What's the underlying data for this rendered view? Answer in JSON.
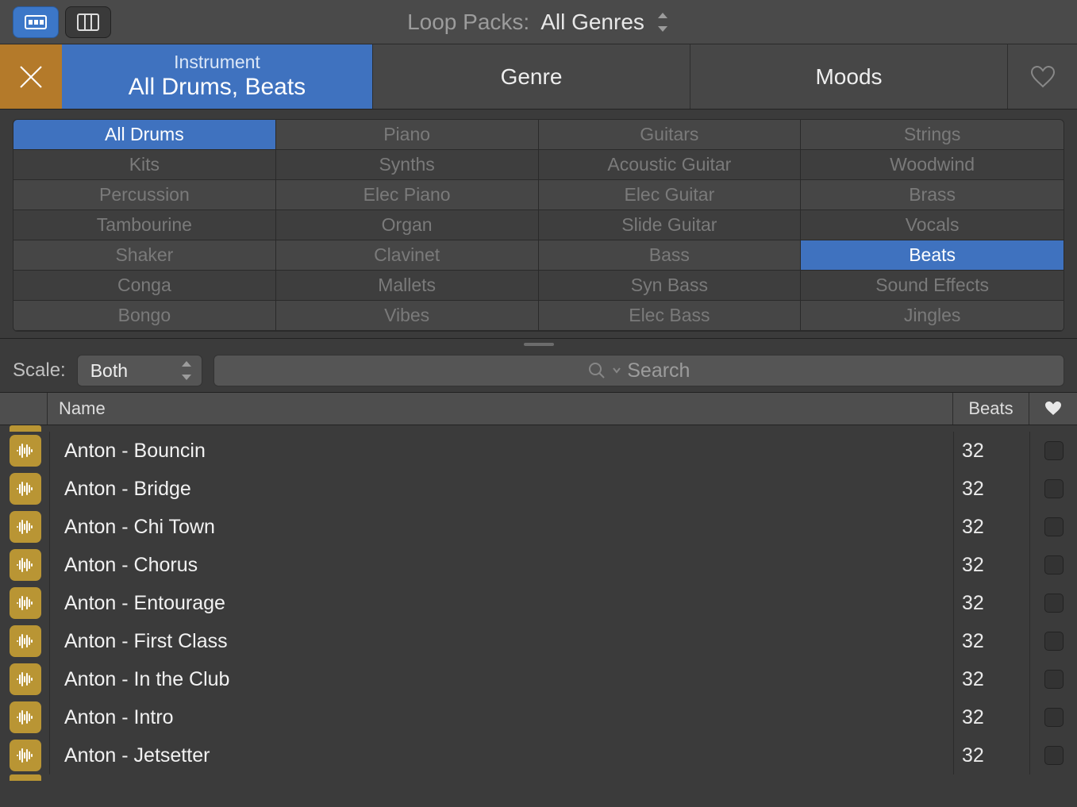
{
  "topbar": {
    "loop_packs_label": "Loop Packs:",
    "loop_packs_value": "All Genres"
  },
  "tabs": {
    "instrument_label": "Instrument",
    "instrument_value": "All Drums, Beats",
    "genre": "Genre",
    "moods": "Moods"
  },
  "categories": {
    "rows": [
      [
        "All Drums",
        "Piano",
        "Guitars",
        "Strings"
      ],
      [
        "Kits",
        "Synths",
        "Acoustic Guitar",
        "Woodwind"
      ],
      [
        "Percussion",
        "Elec Piano",
        "Elec Guitar",
        "Brass"
      ],
      [
        "Tambourine",
        "Organ",
        "Slide Guitar",
        "Vocals"
      ],
      [
        "Shaker",
        "Clavinet",
        "Bass",
        "Beats"
      ],
      [
        "Conga",
        "Mallets",
        "Syn Bass",
        "Sound Effects"
      ],
      [
        "Bongo",
        "Vibes",
        "Elec Bass",
        "Jingles"
      ]
    ],
    "selected": [
      "All Drums",
      "Beats"
    ]
  },
  "scale": {
    "label": "Scale:",
    "value": "Both"
  },
  "search": {
    "placeholder": "Search"
  },
  "table": {
    "headers": {
      "name": "Name",
      "beats": "Beats"
    },
    "rows": [
      {
        "name": "Anton - Bouncin",
        "beats": "32"
      },
      {
        "name": "Anton - Bridge",
        "beats": "32"
      },
      {
        "name": "Anton - Chi Town",
        "beats": "32"
      },
      {
        "name": "Anton - Chorus",
        "beats": "32"
      },
      {
        "name": "Anton - Entourage",
        "beats": "32"
      },
      {
        "name": "Anton - First Class",
        "beats": "32"
      },
      {
        "name": "Anton - In the Club",
        "beats": "32"
      },
      {
        "name": "Anton - Intro",
        "beats": "32"
      },
      {
        "name": "Anton - Jetsetter",
        "beats": "32"
      }
    ]
  }
}
